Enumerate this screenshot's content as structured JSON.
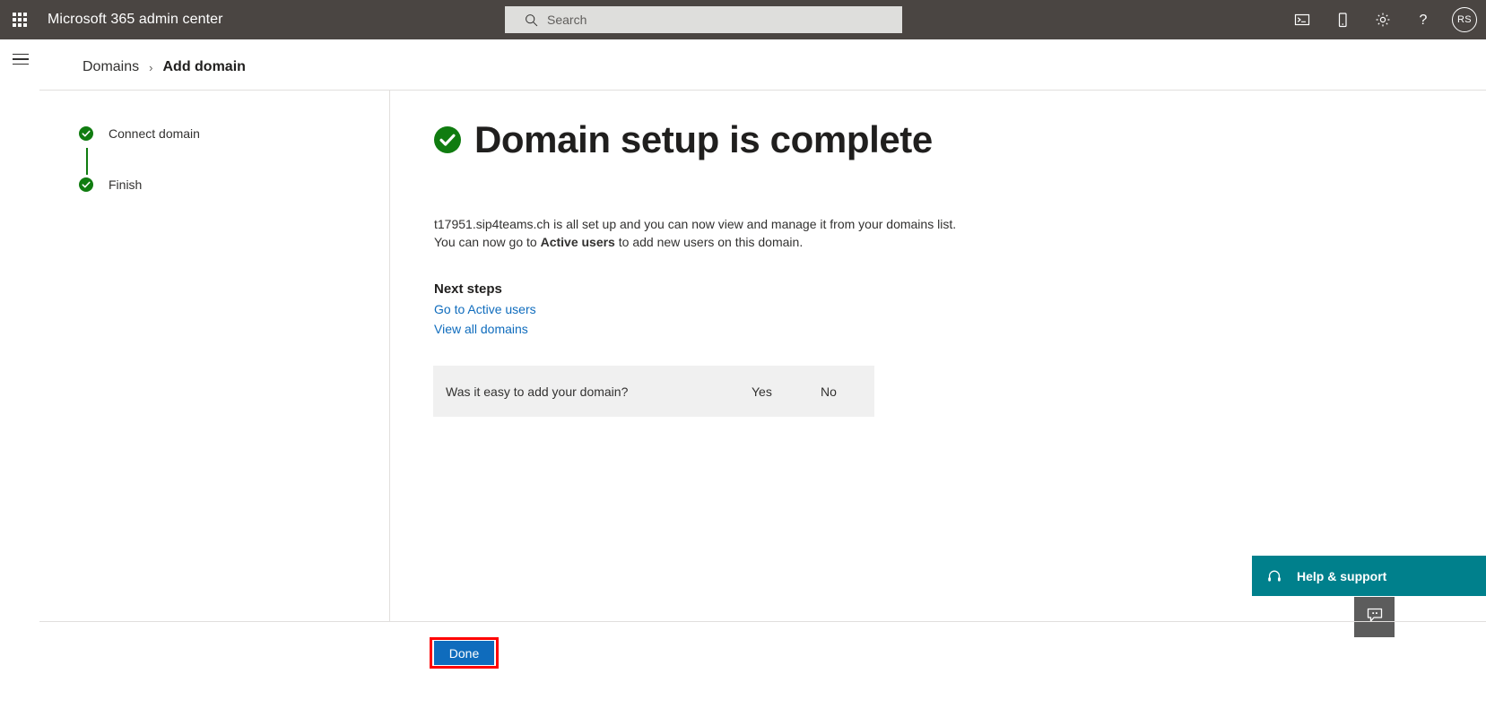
{
  "suite_bar": {
    "waffle_label": "App launcher",
    "title": "Microsoft 365 admin center",
    "search": {
      "placeholder": "Search",
      "value": "",
      "icon": "search-icon"
    },
    "actions": [
      {
        "name": "console-icon",
        "label": "Open console"
      },
      {
        "name": "mobile-device-icon",
        "label": "Mobile app"
      },
      {
        "name": "gear-icon",
        "label": "Settings"
      },
      {
        "name": "help-icon",
        "label": "Help"
      }
    ],
    "avatar": {
      "initials": "RS",
      "label": "Account manager"
    }
  },
  "header": {
    "menu_label": "Show navigation",
    "breadcrumb": {
      "parent": "Domains",
      "separator": "›",
      "current": "Add domain"
    }
  },
  "wizard": {
    "steps": [
      {
        "label": "Connect domain",
        "state": "complete"
      },
      {
        "label": "Finish",
        "state": "complete"
      }
    ]
  },
  "main": {
    "heading": "Domain setup is complete",
    "heading_icon": "check-circle-icon",
    "body_line_1_prefix": "t17951.sip4teams.ch",
    "body_line_1_rest": " is all set up and you can now view and manage it from your domains list.",
    "body_line_2_prefix": "You can now go to ",
    "body_line_2_bold": "Active users",
    "body_line_2_suffix": " to add new users on this domain.",
    "next_steps_title": "Next steps",
    "links": [
      {
        "label": "Go to Active users"
      },
      {
        "label": "View all domains"
      }
    ],
    "survey": {
      "question": "Was it easy to add your domain?",
      "yes": "Yes",
      "no": "No"
    }
  },
  "floating": {
    "help_support_label": "Help & support",
    "help_support_icon": "headset-icon",
    "feedback_icon": "feedback-chat-icon"
  },
  "footer": {
    "done_label": "Done"
  },
  "colors": {
    "suite_bar": "#4a4542",
    "accent_blue": "#0f6cbd",
    "success_green": "#107c10",
    "help_teal": "#00808c",
    "highlight_red": "#ff0000",
    "survey_bg": "#f0f0f0"
  }
}
